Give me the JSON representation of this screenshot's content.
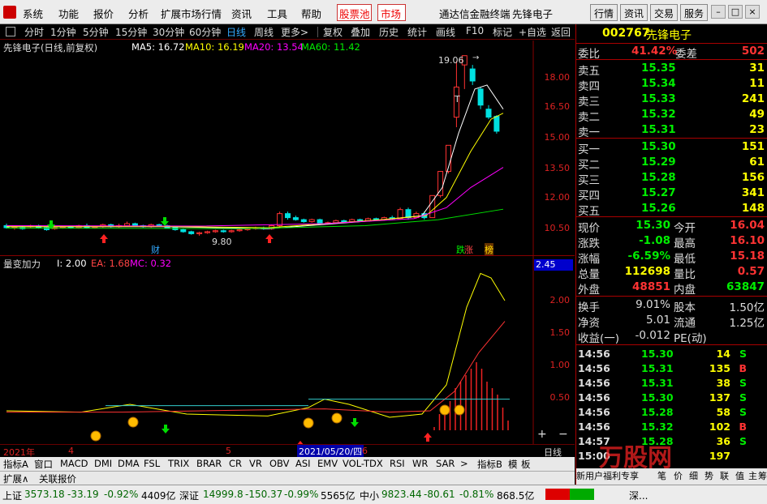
{
  "menu": {
    "items": [
      "系统",
      "功能",
      "报价",
      "分析",
      "扩展市场行情",
      "资讯",
      "工具",
      "帮助"
    ],
    "boxed": [
      "股票池",
      "市场"
    ],
    "app_title": "通达信金融终端",
    "stock_title": "先锋电子",
    "right_buttons": [
      "行情",
      "资讯",
      "交易",
      "服务"
    ]
  },
  "toolbar": {
    "periods": [
      "分时",
      "1分钟",
      "5分钟",
      "15分钟",
      "30分钟",
      "60分钟",
      "日线",
      "周线",
      "更多>"
    ],
    "actions": [
      "复权",
      "叠加",
      "历史",
      "统计",
      "画线",
      "F10",
      "标记",
      "+自选",
      "返回"
    ]
  },
  "main_legend": {
    "name": "先锋电子(日线,前复权)",
    "ma5": "MA5: 16.72",
    "ma10": "MA10: 16.19",
    "ma20": "MA20: 13.54",
    "ma60": "MA60: 11.42"
  },
  "main_axis": [
    "18.00",
    "16.50",
    "15.00",
    "13.50",
    "12.00",
    "10.50"
  ],
  "main_labels": {
    "high": "19.06",
    "low": "9.80",
    "cai": "财",
    "zt": "涨",
    "bang": "榜",
    "t": "T"
  },
  "sub_legend": {
    "name": "量变加力",
    "i": "I: 2.00",
    "ea": "EA: 1.68",
    "mc": "MC: 0.32"
  },
  "sub_axis": [
    "2.45",
    "2.00",
    "1.50",
    "1.00",
    "0.50"
  ],
  "date_axis": {
    "year": "2021年",
    "m4": "4",
    "m5": "5",
    "cursor": "2021/05/20/四",
    "m6": "6",
    "right": "日线"
  },
  "bottom_tabs": [
    "指标A",
    "窗口",
    "MACD",
    "DMI",
    "DMA",
    "FSL",
    "TRIX",
    "BRAR",
    "CR",
    "VR",
    "OBV",
    "ASI",
    "EMV",
    "VOL-TDX",
    "RSI",
    "WR",
    "SAR",
    ">",
    "指标B",
    "模",
    "板"
  ],
  "bottom2": [
    "扩展∧",
    "关联报价"
  ],
  "panel": {
    "code": "002767",
    "name": "先锋电子",
    "weibi_label": "委比",
    "weibi": "41.42%",
    "weicha_label": "委差",
    "weicha": "502",
    "sells": [
      {
        "label": "卖五",
        "price": "15.35",
        "vol": "31"
      },
      {
        "label": "卖四",
        "price": "15.34",
        "vol": "11"
      },
      {
        "label": "卖三",
        "price": "15.33",
        "vol": "241"
      },
      {
        "label": "卖二",
        "price": "15.32",
        "vol": "49"
      },
      {
        "label": "卖一",
        "price": "15.31",
        "vol": "23"
      }
    ],
    "buys": [
      {
        "label": "买一",
        "price": "15.30",
        "vol": "151"
      },
      {
        "label": "买二",
        "price": "15.29",
        "vol": "61"
      },
      {
        "label": "买三",
        "price": "15.28",
        "vol": "156"
      },
      {
        "label": "买四",
        "price": "15.27",
        "vol": "341"
      },
      {
        "label": "买五",
        "price": "15.26",
        "vol": "148"
      }
    ],
    "stats": [
      {
        "l1": "现价",
        "v1": "15.30",
        "l2": "今开",
        "v2": "16.04"
      },
      {
        "l1": "涨跌",
        "v1": "-1.08",
        "l2": "最高",
        "v2": "16.10"
      },
      {
        "l1": "涨幅",
        "v1": "-6.59%",
        "l2": "最低",
        "v2": "15.18"
      },
      {
        "l1": "总量",
        "v1": "112698",
        "l2": "量比",
        "v2": "0.57"
      },
      {
        "l1": "外盘",
        "v1": "48851",
        "l2": "内盘",
        "v2": "63847"
      }
    ],
    "stats2": [
      {
        "l1": "换手",
        "v1": "9.01%",
        "l2": "股本",
        "v2": "1.50亿"
      },
      {
        "l1": "净资",
        "v1": "5.01",
        "l2": "流通",
        "v2": "1.25亿"
      },
      {
        "l1": "收益(一)",
        "v1": "-0.012",
        "l2": "PE(动)",
        "v2": ""
      }
    ],
    "trades": [
      {
        "t": "14:56",
        "p": "15.30",
        "v": "14",
        "s": "S"
      },
      {
        "t": "14:56",
        "p": "15.31",
        "v": "135",
        "s": "B"
      },
      {
        "t": "14:56",
        "p": "15.31",
        "v": "38",
        "s": "S"
      },
      {
        "t": "14:56",
        "p": "15.30",
        "v": "137",
        "s": "S"
      },
      {
        "t": "14:56",
        "p": "15.28",
        "v": "58",
        "s": "S"
      },
      {
        "t": "14:56",
        "p": "15.32",
        "v": "102",
        "s": "B"
      },
      {
        "t": "14:57",
        "p": "15.28",
        "v": "36",
        "s": "S"
      },
      {
        "t": "15:00",
        "p": "",
        "v": "197",
        "s": ""
      }
    ],
    "tabs": [
      "新用户福利专享",
      "笔",
      "价",
      "细",
      "势",
      "联",
      "值",
      "主",
      "筹"
    ]
  },
  "status": {
    "sh_label": "上证",
    "sh_val": "3573.18",
    "sh_chg": "-33.19",
    "sh_pct": "-0.92%",
    "sh_amt": "4409亿",
    "sz_label": "深证",
    "sz_val": "14999.8",
    "sz_chg": "-150.37",
    "sz_pct": "-0.99%",
    "sz_amt": "5565亿",
    "zx_label": "中小",
    "zx_val": "9823.44",
    "zx_chg": "-80.61",
    "zx_pct": "-0.81%",
    "zx_amt": "868.5亿",
    "right": "深..."
  },
  "watermark": "万股网",
  "colors": {
    "up": "#ff3232",
    "down": "#00e0e0",
    "ma5": "#ffffff",
    "ma10": "#ffff00",
    "ma20": "#ff00ff",
    "ma60": "#00e000"
  }
}
